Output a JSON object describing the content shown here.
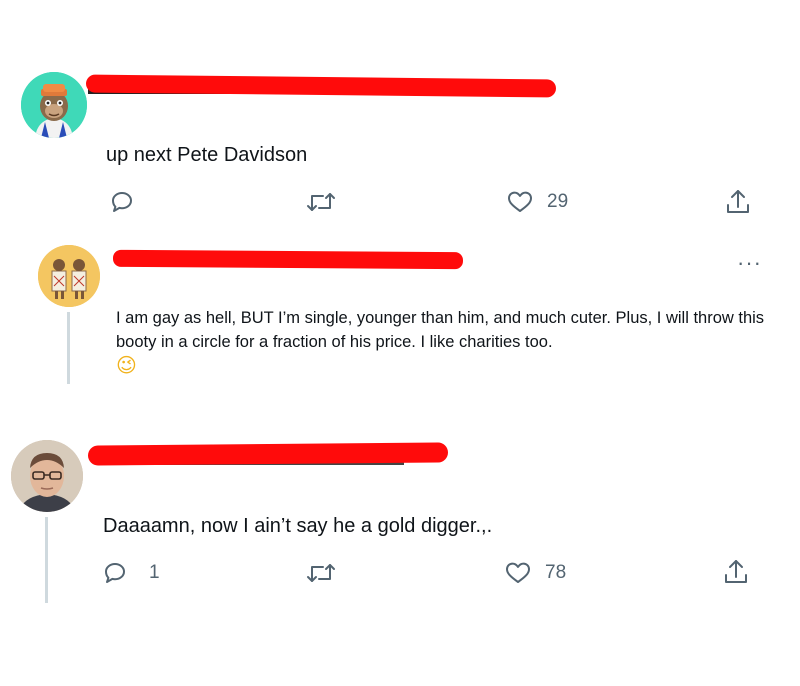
{
  "tweet1": {
    "text": "up next Pete Davidson",
    "reply_count": "",
    "retweet_count": "",
    "like_count": "29",
    "avatar_icon": "ape-avatar-icon"
  },
  "reply1": {
    "text": "I am gay as hell, BUT I’m single, younger than him, and much cuter. Plus, I will throw this booty in a circle for a fraction of his price. I like charities too.",
    "emoji": "😉",
    "more": "···",
    "avatar_icon": "dogs-avatar-icon"
  },
  "reply2": {
    "text": "Daaaamn, now I ain’t say he a gold digger.,.",
    "reply_count": "1",
    "retweet_count": "",
    "like_count": "78",
    "avatar_icon": "man-with-glasses-avatar-icon"
  },
  "colors": {
    "redaction": "#ff0b0b",
    "icon_gray": "#536471",
    "thread_line": "#cfd9de",
    "avatar1_bg": "#3fd9b8",
    "avatar2_bg": "#f4c661"
  }
}
